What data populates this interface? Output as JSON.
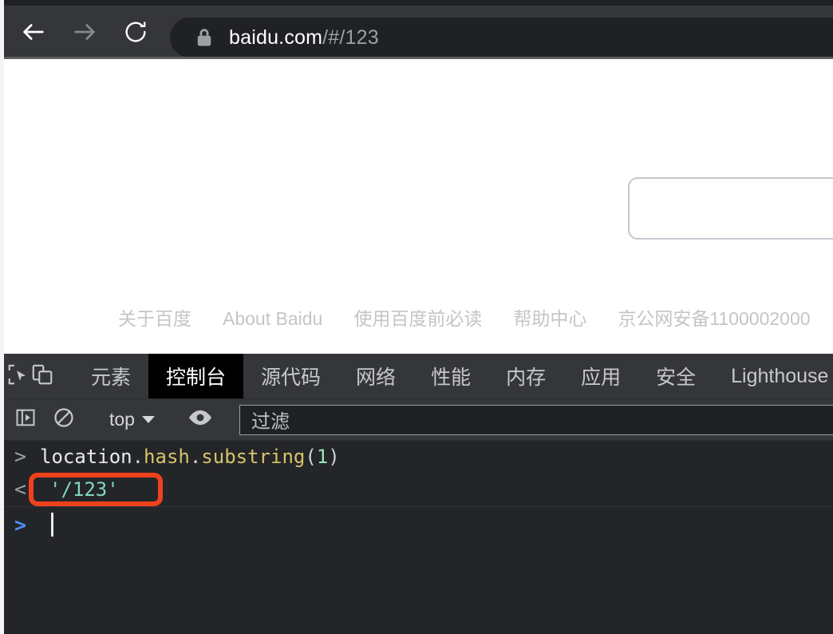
{
  "browser": {
    "back_icon": "arrow-left-icon",
    "forward_icon": "arrow-right-icon",
    "reload_icon": "reload-icon",
    "lock_icon": "lock-icon",
    "url_host": "baidu.com",
    "url_path": "/#/123",
    "url_full": "baidu.com/#/123"
  },
  "page": {
    "search_input_value": "",
    "search_input_placeholder": "",
    "footer_links": [
      "关于百度",
      "About Baidu",
      "使用百度前必读",
      "帮助中心",
      "京公网安备1100002000"
    ]
  },
  "devtools": {
    "inspect_icon": "inspect-element-icon",
    "device_icon": "device-toolbar-icon",
    "tabs": [
      {
        "label": "元素",
        "active": false
      },
      {
        "label": "控制台",
        "active": true
      },
      {
        "label": "源代码",
        "active": false
      },
      {
        "label": "网络",
        "active": false
      },
      {
        "label": "性能",
        "active": false
      },
      {
        "label": "内存",
        "active": false
      },
      {
        "label": "应用",
        "active": false
      },
      {
        "label": "安全",
        "active": false
      },
      {
        "label": "Lighthouse",
        "active": false
      }
    ],
    "console_toolbar": {
      "sidebar_icon": "console-sidebar-icon",
      "clear_icon": "clear-console-icon",
      "context": "top",
      "eye_icon": "live-expression-eye-icon",
      "filter_placeholder": "过滤",
      "filter_value": ""
    },
    "console": {
      "input_prompt": ">",
      "output_prompt": "<",
      "new_prompt": ">",
      "expression": {
        "object": "location",
        "dot1": ".",
        "property": "hash",
        "dot2": ".",
        "method": "substring",
        "paren_open": "(",
        "argument": "1",
        "paren_close": ")",
        "full": "location.hash.substring(1)"
      },
      "result": "'/123'",
      "highlight_color": "#f0411e",
      "result_color": "#80d7c1"
    }
  }
}
